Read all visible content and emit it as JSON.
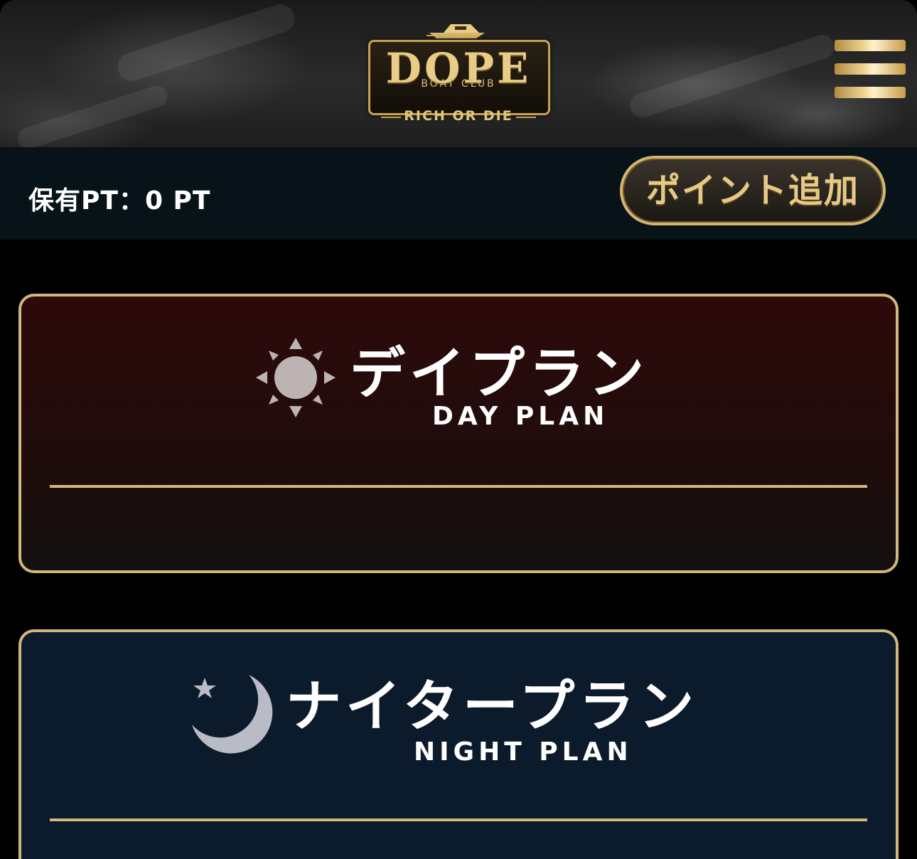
{
  "header": {
    "logo": {
      "brand": "DOPE",
      "sub": "BOAT CLUB",
      "tagline": "RICH OR DIE"
    },
    "menu_icon": "hamburger-menu-icon"
  },
  "points_bar": {
    "balance_text": "保有PT：0 PT",
    "add_button_label": "ポイント追加"
  },
  "plans": [
    {
      "title_jp": "デイプラン",
      "title_en": "DAY PLAN",
      "icon": "sun-icon"
    },
    {
      "title_jp": "ナイタープラン",
      "title_en": "NIGHT PLAN",
      "icon": "moon-star-icon"
    }
  ],
  "colors": {
    "gold": "#d2b67a",
    "day_card_bg": "#2e0a0a",
    "night_card_bg": "#0b1b2c",
    "points_bar_bg": "#071318"
  }
}
